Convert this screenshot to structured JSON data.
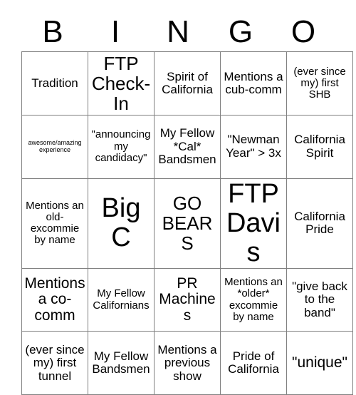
{
  "header": {
    "letters": [
      "B",
      "I",
      "N",
      "G",
      "O"
    ]
  },
  "grid": {
    "rows": [
      [
        {
          "text": "Tradition",
          "size": "sz-md"
        },
        {
          "text": "FTP Check-In",
          "size": "sz-xl"
        },
        {
          "text": "Spirit of California",
          "size": "sz-md"
        },
        {
          "text": "Mentions a cub-comm",
          "size": "sz-md"
        },
        {
          "text": "(ever since my) first SHB",
          "size": "sz-sm"
        }
      ],
      [
        {
          "text": "awesome/amazing experience",
          "size": "sz-xs"
        },
        {
          "text": "\"announcing my candidacy\"",
          "size": "sz-sm"
        },
        {
          "text": "My Fellow *Cal* Bandsmen",
          "size": "sz-md"
        },
        {
          "text": "\"Newman Year\" > 3x",
          "size": "sz-md"
        },
        {
          "text": "California Spirit",
          "size": "sz-md"
        }
      ],
      [
        {
          "text": "Mentions an old-excommie by name",
          "size": "sz-sm"
        },
        {
          "text": "Big C",
          "size": "sz-xxl"
        },
        {
          "text": "GO BEARS",
          "size": "sz-xl"
        },
        {
          "text": "FTP Davis",
          "size": "sz-xxl"
        },
        {
          "text": "California Pride",
          "size": "sz-md"
        }
      ],
      [
        {
          "text": "Mentions a co-comm",
          "size": "sz-lg"
        },
        {
          "text": "My Fellow Californians",
          "size": "sz-sm"
        },
        {
          "text": "PR Machines",
          "size": "sz-lg"
        },
        {
          "text": "Mentions an *older* excommie by name",
          "size": "sz-sm"
        },
        {
          "text": "\"give back to the band\"",
          "size": "sz-md"
        }
      ],
      [
        {
          "text": "(ever since my) first tunnel",
          "size": "sz-md"
        },
        {
          "text": "My Fellow Bandsmen",
          "size": "sz-md"
        },
        {
          "text": "Mentions a previous show",
          "size": "sz-md"
        },
        {
          "text": "Pride of California",
          "size": "sz-md"
        },
        {
          "text": "\"unique\"",
          "size": "sz-lg"
        }
      ]
    ]
  }
}
